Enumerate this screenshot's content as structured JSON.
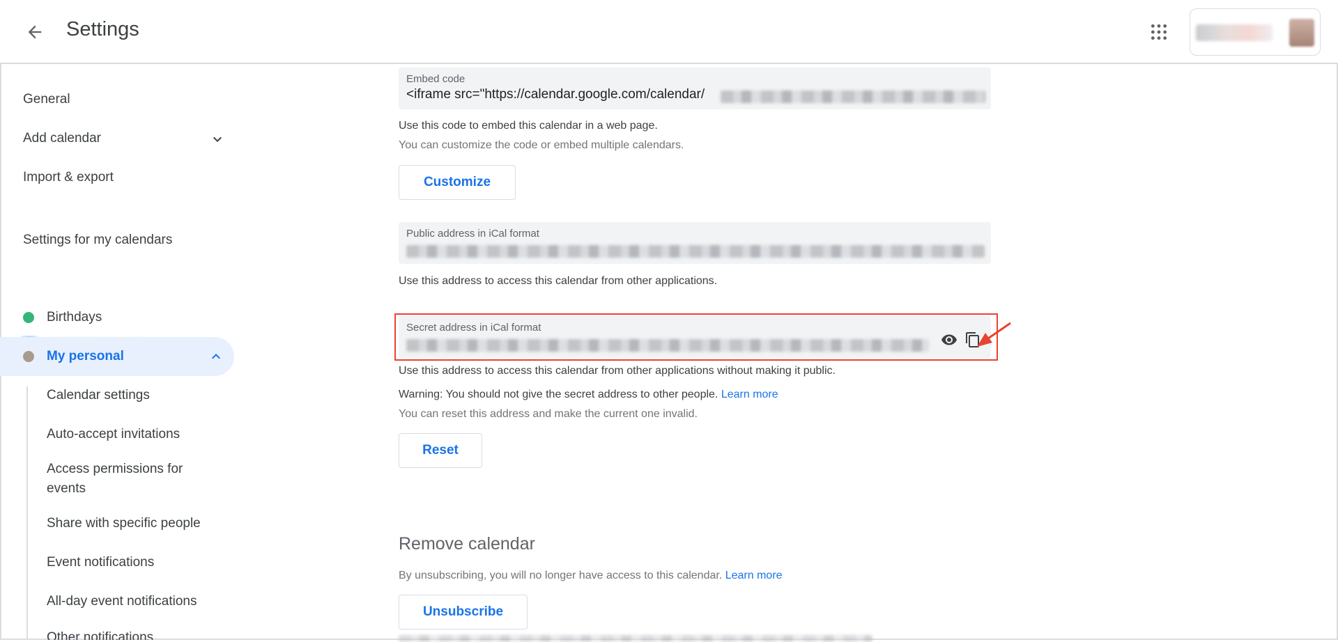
{
  "header": {
    "title": "Settings"
  },
  "sidebar": {
    "general": "General",
    "add_calendar": "Add calendar",
    "import_export": "Import & export",
    "section_title": "Settings for my calendars",
    "birthdays": "Birthdays",
    "my_personal": "My personal",
    "sub_items": [
      "Calendar settings",
      "Auto-accept invitations",
      "Access permissions for events",
      "Share with specific people",
      "Event notifications",
      "All-day event notifications",
      "Other notifications"
    ]
  },
  "main": {
    "embed": {
      "label": "Embed code",
      "value": "<iframe src=\"https://calendar.google.com/calendar/",
      "desc": "Use this code to embed this calendar in a web page.",
      "desc2": "You can customize the code or embed multiple calendars.",
      "button": "Customize"
    },
    "public": {
      "label": "Public address in iCal format",
      "desc": "Use this address to access this calendar from other applications."
    },
    "secret": {
      "label": "Secret address in iCal format",
      "desc": "Use this address to access this calendar from other applications without making it public.",
      "warning": "Warning: You should not give the secret address to other people.",
      "warning_link": "Learn more",
      "reset_desc": "You can reset this address and make the current one invalid.",
      "button": "Reset"
    },
    "remove": {
      "title": "Remove calendar",
      "desc": "By unsubscribing, you will no longer have access to this calendar.",
      "link": "Learn more",
      "button": "Unsubscribe"
    }
  },
  "colors": {
    "accent": "#1a73e8",
    "birthdays_dot": "#33b679",
    "my_personal_dot": "#a79b8e",
    "annotation": "#e8432f"
  },
  "icons": [
    "arrow-back-icon",
    "apps-grid-icon",
    "chevron-down-icon",
    "chevron-up-icon",
    "eye-icon",
    "copy-icon",
    "annotation-arrow-icon"
  ]
}
